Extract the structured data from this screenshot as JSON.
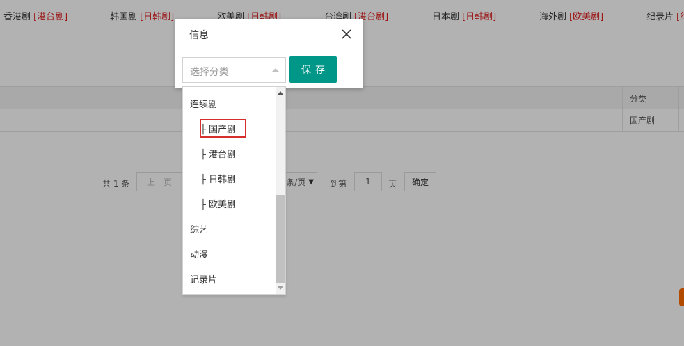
{
  "topnav": {
    "items": [
      {
        "name": "香港剧",
        "tag": "[港台剧]"
      },
      {
        "name": "韩国剧",
        "tag": "[日韩剧]"
      },
      {
        "name": "欧美剧",
        "tag": "[日韩剧]"
      },
      {
        "name": "台湾剧",
        "tag": "[港台剧]"
      },
      {
        "name": "日本剧",
        "tag": "[日韩剧]"
      },
      {
        "name": "海外剧",
        "tag": "[欧美剧]"
      },
      {
        "name": "纪录片",
        "tag": "[纪"
      }
    ]
  },
  "table": {
    "header": {
      "category": "分类"
    },
    "rows": [
      {
        "category": "国产剧"
      }
    ]
  },
  "pager": {
    "total": "共 1 条",
    "prev": "上一页",
    "per_page": "条/页",
    "goto": "到第",
    "page_value": "1",
    "page_unit": "页",
    "confirm": "确定"
  },
  "dialog": {
    "title": "信息",
    "select_placeholder": "选择分类",
    "save_label": "保存"
  },
  "dropdown": {
    "items": [
      {
        "label": "连续剧",
        "level": "parent"
      },
      {
        "label": "├ 国产剧",
        "level": "child",
        "selected": true
      },
      {
        "label": "├ 港台剧",
        "level": "child"
      },
      {
        "label": "├ 日韩剧",
        "level": "child"
      },
      {
        "label": "├ 欧美剧",
        "level": "child"
      },
      {
        "label": "综艺",
        "level": "parent"
      },
      {
        "label": "动漫",
        "level": "parent"
      },
      {
        "label": "记录片",
        "level": "parent"
      }
    ]
  },
  "colors": {
    "accent": "#009688",
    "tag_red": "#e02020",
    "highlight": "#d62d2d"
  }
}
